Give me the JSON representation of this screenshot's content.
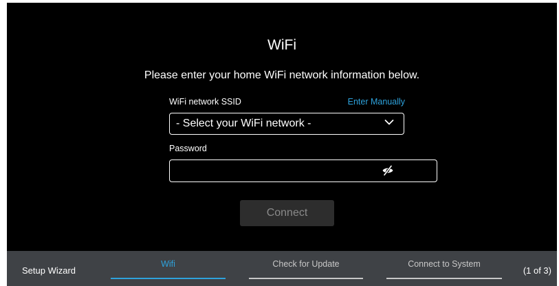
{
  "colors": {
    "background": "#000000",
    "accent": "#2ea3dd",
    "footer": "#3f4246",
    "inactive_step": "#c8c8c8",
    "button_bg": "#2d2d2d",
    "button_text": "#8a8a8a"
  },
  "page": {
    "title": "WiFi",
    "subtitle": "Please enter your home WiFi network information below."
  },
  "form": {
    "ssid_label": "WiFi network SSID",
    "enter_manually": "Enter Manually",
    "ssid_select_value": "- Select your WiFi network -",
    "password_label": "Password",
    "password_value": "",
    "connect_label": "Connect"
  },
  "icons": {
    "dropdown": "chevron-down-icon",
    "password_visibility": "eye-off-icon"
  },
  "footer": {
    "title": "Setup Wizard",
    "steps": [
      {
        "label": "Wifi",
        "active": true
      },
      {
        "label": "Check for Update",
        "active": false
      },
      {
        "label": "Connect to System",
        "active": false
      }
    ],
    "step_count": "(1 of 3)"
  }
}
